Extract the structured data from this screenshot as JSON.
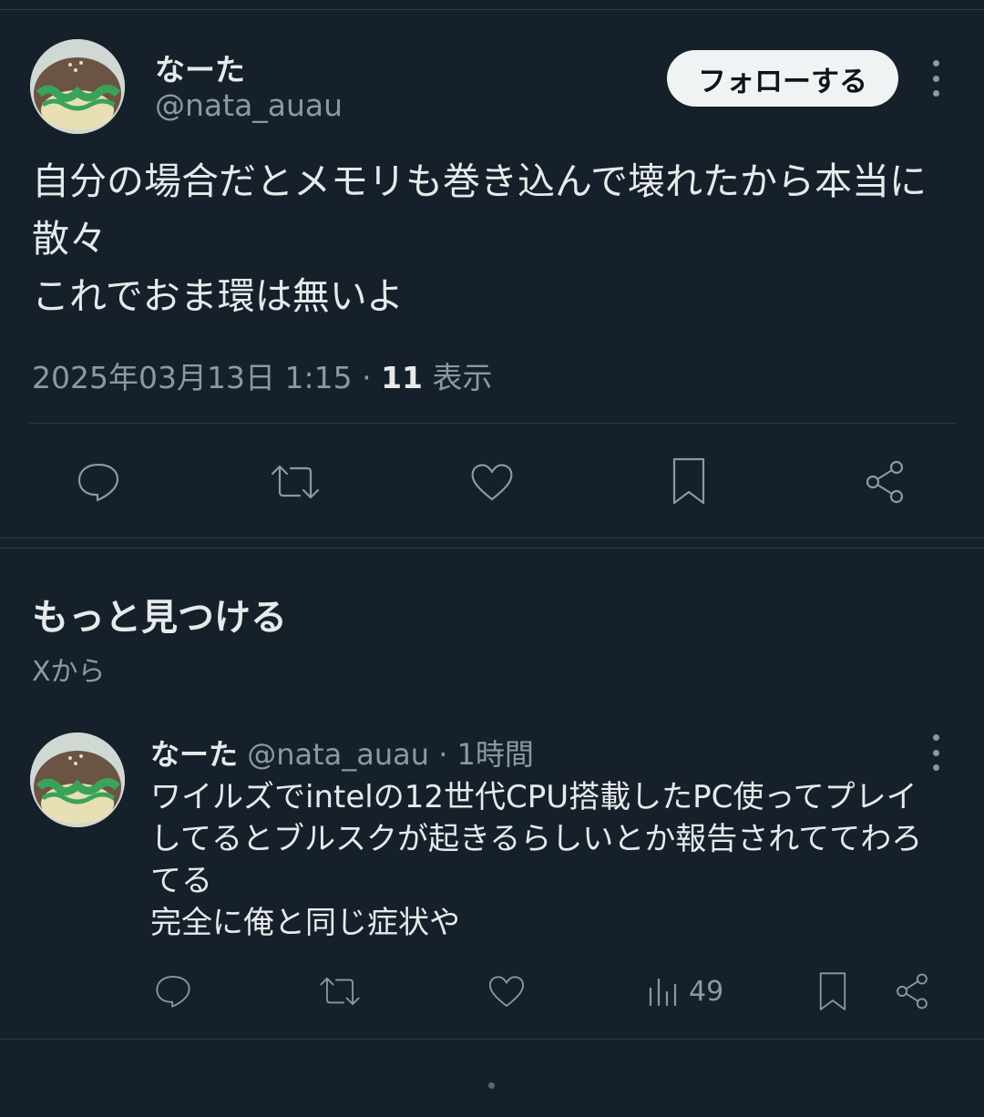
{
  "tweet": {
    "display_name": "なーた",
    "handle": "@nata_auau",
    "follow_label": "フォローする",
    "text_lines": [
      "自分の場合だとメモリも巻き込んで壊れたから本当に",
      "散々",
      "これでおま環は無いよ"
    ],
    "timestamp": "2025年03月13日 1:15",
    "separator": "·",
    "view_count": "11",
    "view_label": "表示"
  },
  "discover": {
    "title": "もっと見つける",
    "source": "Xから"
  },
  "related": {
    "display_name": "なーた",
    "handle": "@nata_auau",
    "time": "· 1時間",
    "text_lines": [
      "ワイルズでintelの12世代CPU搭載したPC使ってプレイ",
      "してるとブルスクが起きるらしいとか報告されててわろ",
      "てる",
      "完全に俺と同じ症状や"
    ],
    "views": "49"
  },
  "icons": {
    "reply": "reply-icon",
    "retweet": "retweet-icon",
    "like": "like-icon",
    "bookmark": "bookmark-icon",
    "share": "share-icon",
    "views": "views-icon",
    "more": "more-icon"
  },
  "colors": {
    "background": "#15202b",
    "text": "#e7e9ea",
    "secondary": "#8b98a5",
    "follow_button": "#eff3f4"
  }
}
